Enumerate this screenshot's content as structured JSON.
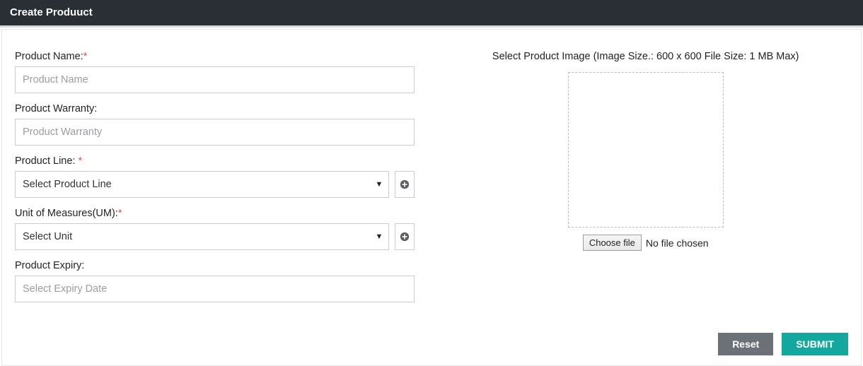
{
  "header": {
    "title": "Create Produuct"
  },
  "form": {
    "productName": {
      "label": "Product Name:",
      "required": "*",
      "placeholder": "Product Name"
    },
    "productWarranty": {
      "label": "Product Warranty:",
      "placeholder": "Product Warranty"
    },
    "productLine": {
      "label": "Product Line: ",
      "required": "*",
      "selected": "Select Product Line"
    },
    "unitOfMeasures": {
      "label": "Unit of Measures(UM):",
      "required": "*",
      "selected": "Select Unit"
    },
    "productExpiry": {
      "label": "Product Expiry:",
      "placeholder": "Select Expiry Date"
    }
  },
  "image": {
    "label": "Select Product Image (Image Size.: 600 x 600 File Size: 1 MB Max)",
    "chooseLabel": "Choose file",
    "status": "No file chosen"
  },
  "buttons": {
    "reset": "Reset",
    "submit": "SUBMIT"
  }
}
